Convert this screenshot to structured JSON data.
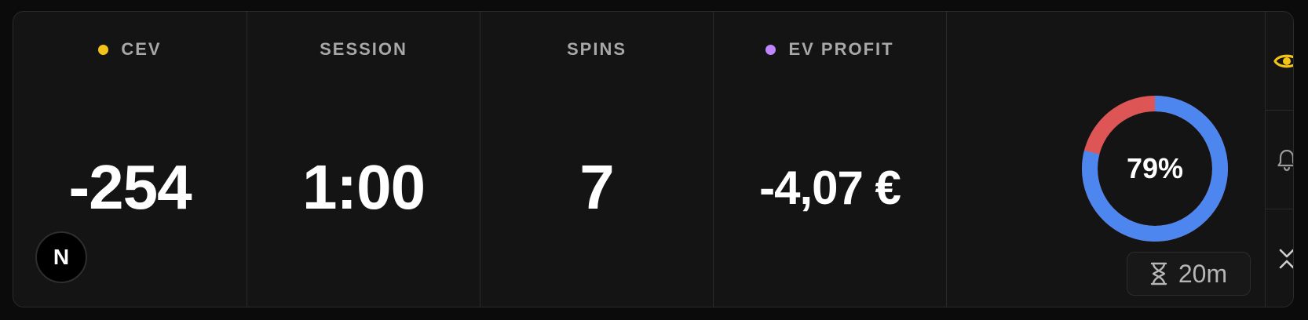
{
  "stats": [
    {
      "label": "CEV",
      "value": "-254",
      "dot_color": "#f2c418"
    },
    {
      "label": "SESSION",
      "value": "1:00"
    },
    {
      "label": "SPINS",
      "value": "7"
    },
    {
      "label": "EV PROFIT",
      "value": "-4,07 €",
      "dot_color": "#c084fc"
    }
  ],
  "logo": {
    "letter": "N"
  },
  "donut": {
    "percent_label": "79%",
    "fraction": 0.79,
    "main_color": "#4e86f0",
    "rest_color": "#dd5555"
  },
  "timer": {
    "label": "20m",
    "icon": "hourglass-icon"
  },
  "side_controls": [
    {
      "icon": "eye-icon",
      "color": "#f2c418"
    },
    {
      "icon": "bell-icon",
      "color": "#9a9a9a"
    },
    {
      "icon": "collapse-icon",
      "color": "#cfcfcf"
    }
  ]
}
